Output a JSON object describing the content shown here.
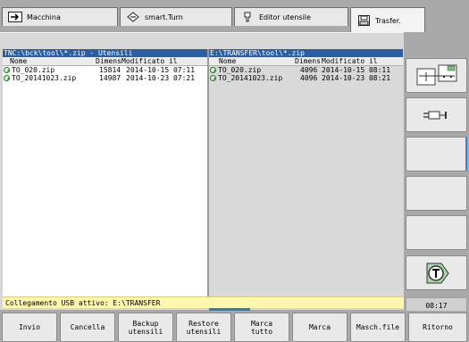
{
  "tabs": [
    {
      "label": "Macchina",
      "icon": "arrow-right-icon"
    },
    {
      "label": "smart.Turn",
      "icon": "diamond-arrows-icon"
    },
    {
      "label": "Editor utensile",
      "icon": "tool-holder-icon"
    },
    {
      "label": "Trasfer.",
      "icon": "floppy-disk-icon"
    }
  ],
  "left_panel": {
    "path": "TNC:\\bck\\tool\\*.zip - Utensili",
    "col_name": "Nome",
    "col_size": "Dimens",
    "col_modified": "Modificato il",
    "files": [
      {
        "name": "TO_020.zip",
        "size": "15814",
        "date": "2014-10-15 07:11"
      },
      {
        "name": "TO_20141023.zip",
        "size": "14987",
        "date": "2014-10-23 07:21"
      }
    ]
  },
  "right_panel": {
    "path": "E:\\TRANSFER\\tool\\*.zip",
    "col_name": "Nome",
    "col_size": "Dimens",
    "col_modified": "Modificato il",
    "files": [
      {
        "name": "TO_020.zip",
        "size": "4096",
        "date": "2014-10-15 08:11"
      },
      {
        "name": "TO_20141023.zip",
        "size": "4096",
        "date": "2014-10-23 08:21"
      }
    ]
  },
  "status": {
    "message": "Collegamento USB attivo: E:\\TRANSFER"
  },
  "clock": "08:17",
  "side_softkeys": [
    {
      "icon": "file-transfer-icon"
    },
    {
      "icon": "usb-plug-icon"
    },
    {
      "icon": ""
    },
    {
      "icon": ""
    },
    {
      "icon": ""
    },
    {
      "icon": "tool-transfer-icon"
    }
  ],
  "bottom_softkeys": [
    "Invio",
    "Cancella",
    "Backup\nutensili",
    "Restore\nutensili",
    "Marca\ntutto",
    "Marca",
    "Masch.file",
    "Ritorno"
  ]
}
